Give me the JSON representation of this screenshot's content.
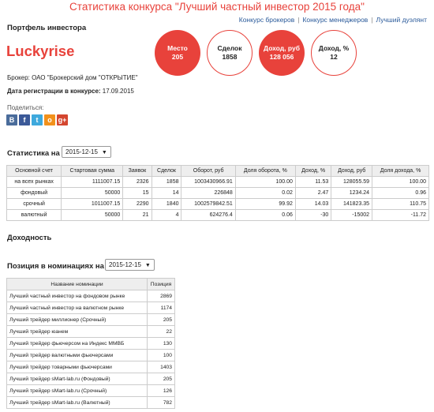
{
  "title": "Статистика конкурса \"Лучший частный инвестор 2015 года\"",
  "top_links": [
    "Конкурс брокеров",
    "Конкурс менеджеров",
    "Лучший дуэлянт"
  ],
  "portfolio_label": "Портфель инвестора",
  "username": "Luckyrise",
  "circles": [
    {
      "label": "Место",
      "value": "205"
    },
    {
      "label": "Сделок",
      "value": "1858"
    },
    {
      "label": "Доход, руб",
      "value": "128 056"
    },
    {
      "label": "Доход, %",
      "value": "12"
    }
  ],
  "broker_label": "Брокер:",
  "broker_value": "ОАО \"Брокерский дом \"ОТКРЫТИЕ\"",
  "reg_label": "Дата регистрации в конкурсе:",
  "reg_value": "17.09.2015",
  "share_label": "Поделиться:",
  "share_icons": [
    {
      "name": "vk-icon",
      "glyph": "B",
      "color": "#4a6c9b"
    },
    {
      "name": "facebook-icon",
      "glyph": "f",
      "color": "#3b5998"
    },
    {
      "name": "twitter-icon",
      "glyph": "t",
      "color": "#3ea9dd"
    },
    {
      "name": "odnoklassniki-icon",
      "glyph": "o",
      "color": "#f2911b"
    },
    {
      "name": "google-plus-icon",
      "glyph": "g+",
      "color": "#d4462f"
    }
  ],
  "stats_label": "Статистика на",
  "stats_date": "2015-12-15",
  "stats_table": {
    "headers": [
      "Основной счет",
      "Стартовая сумма",
      "Заявок",
      "Сделок",
      "Оборот, руб",
      "Доля оборота, %",
      "Доход, %",
      "Доход, руб",
      "Доля дохода, %"
    ],
    "rows": [
      [
        "на всех рынках",
        "1111007.15",
        "2326",
        "1858",
        "1003430966.91",
        "100.00",
        "11.53",
        "128055.59",
        "100.00"
      ],
      [
        "фондовый",
        "50000",
        "15",
        "14",
        "226848",
        "0.02",
        "2.47",
        "1234.24",
        "0.96"
      ],
      [
        "срочный",
        "1011007.15",
        "2290",
        "1840",
        "1002579842.51",
        "99.92",
        "14.03",
        "141823.35",
        "110.75"
      ],
      [
        "валютный",
        "50000",
        "21",
        "4",
        "624276.4",
        "0.06",
        "-30",
        "-15002",
        "-11.72"
      ]
    ]
  },
  "income_label": "Доходность",
  "nominations_label": "Позиция в номинациях на",
  "nominations_date": "2015-12-15",
  "nominations_table": {
    "headers": [
      "Название номинации",
      "Позиция"
    ],
    "rows": [
      [
        "Лучший частный инвестор на фондовом рынке",
        "2869"
      ],
      [
        "Лучший частный инвестор на валютном рынке",
        "1174"
      ],
      [
        "Лучший трейдер миллионер (Срочный)",
        "205"
      ],
      [
        "Лучший трейдер юанем",
        "22"
      ],
      [
        "Лучший трейдер фьючерсом на Индекс ММВБ",
        "130"
      ],
      [
        "Лучший трейдер валютными фьючерсами",
        "100"
      ],
      [
        "Лучший трейдер товарными фьючерсами",
        "1403"
      ],
      [
        "Лучший трейдер sMart-lab.ru (Фондовый)",
        "205"
      ],
      [
        "Лучший трейдер sMart-lab.ru (Срочный)",
        "126"
      ],
      [
        "Лучший трейдер sMart-lab.ru (Валютный)",
        "782"
      ]
    ]
  },
  "colors": {
    "accent": "#e8423b",
    "link": "#2a5a9a",
    "table_header": "#eeeeee",
    "border": "#cccccc"
  }
}
